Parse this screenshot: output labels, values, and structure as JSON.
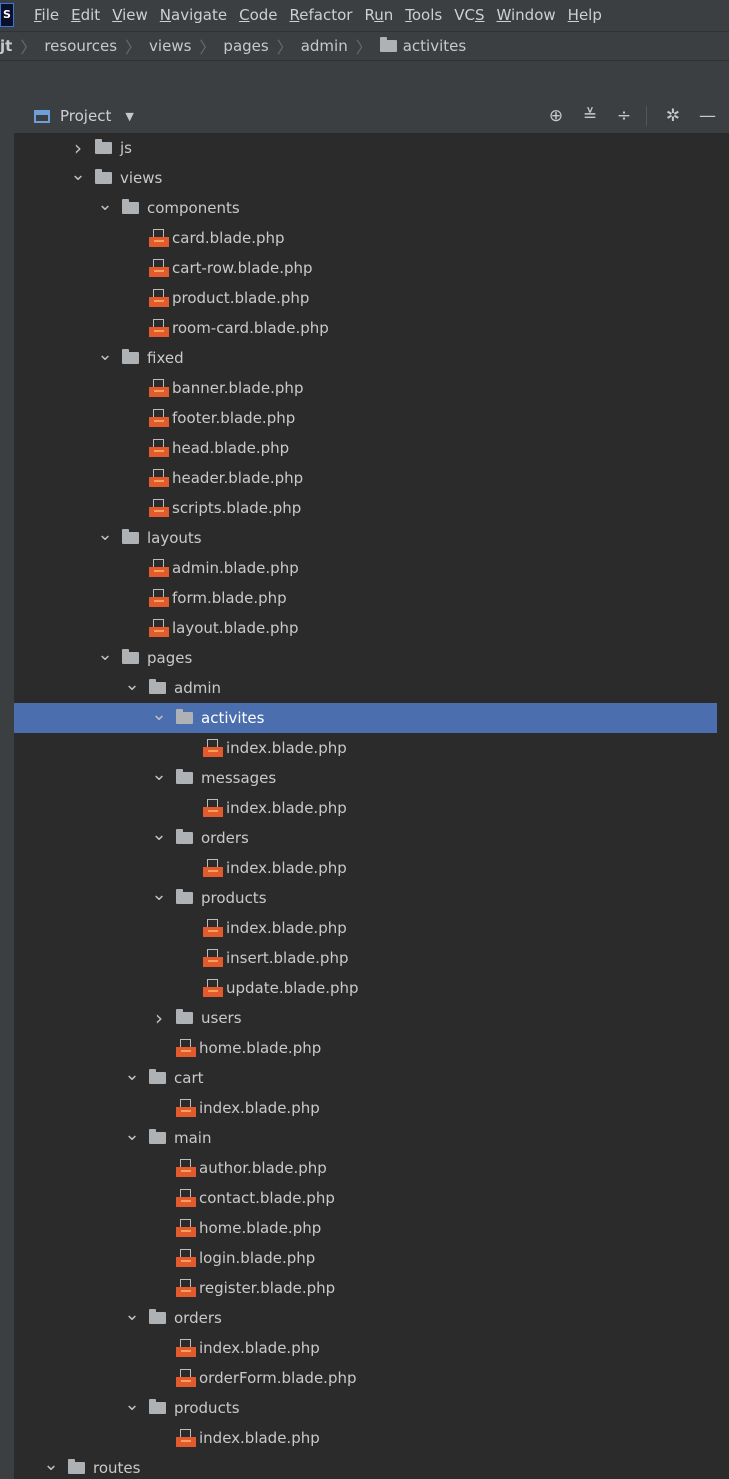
{
  "menubar": {
    "logo": "S",
    "items": [
      {
        "label": "File",
        "mnemonic": "F",
        "rest": "ile"
      },
      {
        "label": "Edit",
        "mnemonic": "E",
        "rest": "dit"
      },
      {
        "label": "View",
        "mnemonic": "V",
        "rest": "iew"
      },
      {
        "label": "Navigate",
        "mnemonic": "N",
        "rest": "avigate"
      },
      {
        "label": "Code",
        "mnemonic": "C",
        "rest": "ode"
      },
      {
        "label": "Refactor",
        "mnemonic": "R",
        "rest": "efactor"
      },
      {
        "label": "Run",
        "prefix": "R",
        "mnemonic": "u",
        "rest": "n"
      },
      {
        "label": "Tools",
        "mnemonic": "T",
        "rest": "ools"
      },
      {
        "label": "VCS",
        "prefix": "VC",
        "mnemonic": "S",
        "rest": ""
      },
      {
        "label": "Window",
        "mnemonic": "W",
        "rest": "indow"
      },
      {
        "label": "Help",
        "mnemonic": "H",
        "rest": "elp"
      }
    ]
  },
  "breadcrumb": {
    "items": [
      "jt",
      "resources",
      "views",
      "pages",
      "admin",
      "activites"
    ]
  },
  "toolbar": {
    "title": "Project",
    "icons": [
      "locate-icon",
      "expand-all-icon",
      "collapse-all-icon",
      "gear-icon",
      "minimize-icon"
    ]
  },
  "tree": [
    {
      "type": "folder",
      "label": "js",
      "depth": 0,
      "state": "collapsed"
    },
    {
      "type": "folder",
      "label": "views",
      "depth": 0,
      "state": "expanded"
    },
    {
      "type": "folder",
      "label": "components",
      "depth": 1,
      "state": "expanded"
    },
    {
      "type": "file",
      "label": "card.blade.php",
      "depth": 2
    },
    {
      "type": "file",
      "label": "cart-row.blade.php",
      "depth": 2
    },
    {
      "type": "file",
      "label": "product.blade.php",
      "depth": 2
    },
    {
      "type": "file",
      "label": "room-card.blade.php",
      "depth": 2
    },
    {
      "type": "folder",
      "label": "fixed",
      "depth": 1,
      "state": "expanded"
    },
    {
      "type": "file",
      "label": "banner.blade.php",
      "depth": 2
    },
    {
      "type": "file",
      "label": "footer.blade.php",
      "depth": 2
    },
    {
      "type": "file",
      "label": "head.blade.php",
      "depth": 2
    },
    {
      "type": "file",
      "label": "header.blade.php",
      "depth": 2
    },
    {
      "type": "file",
      "label": "scripts.blade.php",
      "depth": 2
    },
    {
      "type": "folder",
      "label": "layouts",
      "depth": 1,
      "state": "expanded"
    },
    {
      "type": "file",
      "label": "admin.blade.php",
      "depth": 2
    },
    {
      "type": "file",
      "label": "form.blade.php",
      "depth": 2
    },
    {
      "type": "file",
      "label": "layout.blade.php",
      "depth": 2
    },
    {
      "type": "folder",
      "label": "pages",
      "depth": 1,
      "state": "expanded"
    },
    {
      "type": "folder",
      "label": "admin",
      "depth": 2,
      "state": "expanded"
    },
    {
      "type": "folder",
      "label": "activites",
      "depth": 3,
      "state": "expanded",
      "selected": true
    },
    {
      "type": "file",
      "label": "index.blade.php",
      "depth": 4
    },
    {
      "type": "folder",
      "label": "messages",
      "depth": 3,
      "state": "expanded"
    },
    {
      "type": "file",
      "label": "index.blade.php",
      "depth": 4
    },
    {
      "type": "folder",
      "label": "orders",
      "depth": 3,
      "state": "expanded"
    },
    {
      "type": "file",
      "label": "index.blade.php",
      "depth": 4
    },
    {
      "type": "folder",
      "label": "products",
      "depth": 3,
      "state": "expanded"
    },
    {
      "type": "file",
      "label": "index.blade.php",
      "depth": 4
    },
    {
      "type": "file",
      "label": "insert.blade.php",
      "depth": 4
    },
    {
      "type": "file",
      "label": "update.blade.php",
      "depth": 4
    },
    {
      "type": "folder",
      "label": "users",
      "depth": 3,
      "state": "collapsed"
    },
    {
      "type": "file",
      "label": "home.blade.php",
      "depth": 3
    },
    {
      "type": "folder",
      "label": "cart",
      "depth": 2,
      "state": "expanded"
    },
    {
      "type": "file",
      "label": "index.blade.php",
      "depth": 3
    },
    {
      "type": "folder",
      "label": "main",
      "depth": 2,
      "state": "expanded"
    },
    {
      "type": "file",
      "label": "author.blade.php",
      "depth": 3
    },
    {
      "type": "file",
      "label": "contact.blade.php",
      "depth": 3
    },
    {
      "type": "file",
      "label": "home.blade.php",
      "depth": 3
    },
    {
      "type": "file",
      "label": "login.blade.php",
      "depth": 3
    },
    {
      "type": "file",
      "label": "register.blade.php",
      "depth": 3
    },
    {
      "type": "folder",
      "label": "orders",
      "depth": 2,
      "state": "expanded"
    },
    {
      "type": "file",
      "label": "index.blade.php",
      "depth": 3
    },
    {
      "type": "file",
      "label": "orderForm.blade.php",
      "depth": 3
    },
    {
      "type": "folder",
      "label": "products",
      "depth": 2,
      "state": "expanded"
    },
    {
      "type": "file",
      "label": "index.blade.php",
      "depth": 3
    },
    {
      "type": "folder",
      "label": "routes",
      "depth": -1,
      "state": "expanded"
    }
  ],
  "colors": {
    "background": "#2b2b2b",
    "panel": "#3c3f41",
    "selection": "#4b6eaf",
    "blade_icon": "#e35b2d"
  }
}
